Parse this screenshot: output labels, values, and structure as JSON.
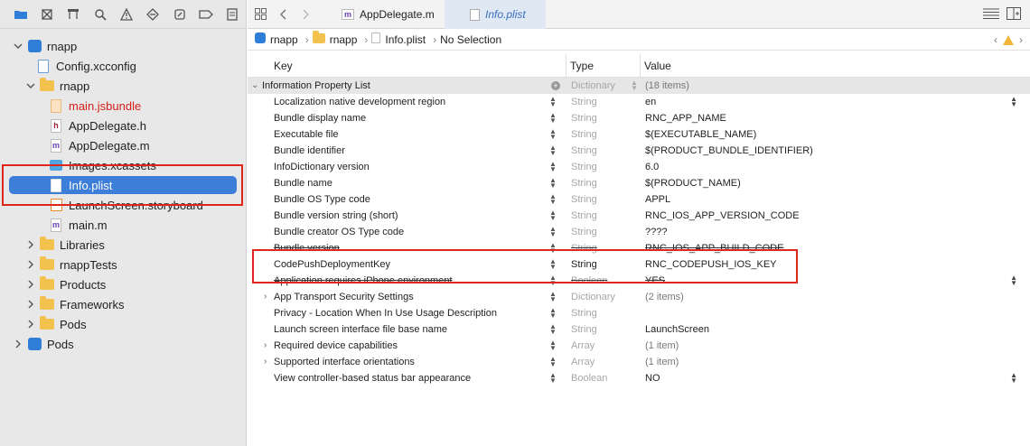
{
  "navigator": {
    "toolbar_icons": [
      "folder-icon",
      "source-control-icon",
      "hierarchy-icon",
      "find-icon",
      "issue-icon",
      "test-icon",
      "debug-icon",
      "breakpoint-icon",
      "report-icon"
    ],
    "items": [
      {
        "label": "rnapp",
        "disclosure": "open",
        "icon": "project-icon"
      },
      {
        "label": "Config.xcconfig",
        "icon": "file-icon"
      },
      {
        "label": "rnapp",
        "disclosure": "open",
        "icon": "folder-icon"
      },
      {
        "label": "main.jsbundle",
        "icon": "bundle-file-icon",
        "missing": true
      },
      {
        "label": "AppDelegate.h",
        "icon": "header-file-icon"
      },
      {
        "label": "AppDelegate.m",
        "icon": "objc-file-icon"
      },
      {
        "label": "Images.xcassets",
        "icon": "asset-catalog-icon"
      },
      {
        "label": "Info.plist",
        "icon": "plist-file-icon",
        "selected": true
      },
      {
        "label": "LaunchScreen.storyboard",
        "icon": "storyboard-icon"
      },
      {
        "label": "main.m",
        "icon": "objc-file-icon"
      },
      {
        "label": "Libraries",
        "disclosure": "closed",
        "icon": "folder-icon"
      },
      {
        "label": "rnappTests",
        "disclosure": "closed",
        "icon": "folder-icon"
      },
      {
        "label": "Products",
        "disclosure": "closed",
        "icon": "folder-icon"
      },
      {
        "label": "Frameworks",
        "disclosure": "closed",
        "icon": "folder-icon"
      },
      {
        "label": "Pods",
        "disclosure": "closed",
        "icon": "folder-icon"
      },
      {
        "label": "Pods",
        "disclosure": "closed",
        "icon": "project-icon"
      }
    ]
  },
  "tabs": [
    {
      "label": "AppDelegate.m",
      "active": false
    },
    {
      "label": "Info.plist",
      "active": true
    }
  ],
  "breadcrumb": [
    "rnapp",
    "rnapp",
    "Info.plist",
    "No Selection"
  ],
  "plist": {
    "headers": {
      "key": "Key",
      "type": "Type",
      "value": "Value"
    },
    "root": {
      "key": "Information Property List",
      "type": "Dictionary",
      "value": "(18 items)"
    },
    "rows": [
      {
        "key": "Localization native development region",
        "type": "String",
        "value": "en"
      },
      {
        "key": "Bundle display name",
        "type": "String",
        "value": "RNC_APP_NAME"
      },
      {
        "key": "Executable file",
        "type": "String",
        "value": "$(EXECUTABLE_NAME)"
      },
      {
        "key": "Bundle identifier",
        "type": "String",
        "value": "$(PRODUCT_BUNDLE_IDENTIFIER)"
      },
      {
        "key": "InfoDictionary version",
        "type": "String",
        "value": "6.0"
      },
      {
        "key": "Bundle name",
        "type": "String",
        "value": "$(PRODUCT_NAME)"
      },
      {
        "key": "Bundle OS Type code",
        "type": "String",
        "value": "APPL"
      },
      {
        "key": "Bundle version string (short)",
        "type": "String",
        "value": "RNC_IOS_APP_VERSION_CODE"
      },
      {
        "key": "Bundle creator OS Type code",
        "type": "String",
        "value": "????"
      },
      {
        "key": "Bundle version",
        "type": "String",
        "value": "RNC_IOS_APP_BUILD_CODE"
      },
      {
        "key": "CodePushDeploymentKey",
        "type": "String",
        "value": "RNC_CODEPUSH_IOS_KEY"
      },
      {
        "key": "Application requires iPhone environment",
        "type": "Boolean",
        "value": "YES"
      },
      {
        "key": "App Transport Security Settings",
        "type": "Dictionary",
        "value": "(2 items)"
      },
      {
        "key": "Privacy - Location When In Use Usage Description",
        "type": "String",
        "value": ""
      },
      {
        "key": "Launch screen interface file base name",
        "type": "String",
        "value": "LaunchScreen"
      },
      {
        "key": "Required device capabilities",
        "type": "Array",
        "value": "(1 item)"
      },
      {
        "key": "Supported interface orientations",
        "type": "Array",
        "value": "(1 item)"
      },
      {
        "key": "View controller-based status bar appearance",
        "type": "Boolean",
        "value": "NO"
      }
    ]
  },
  "colors": {
    "selection": "#3d7fd8",
    "highlight_box": "#e0251b",
    "missing_file": "#d6201a"
  }
}
